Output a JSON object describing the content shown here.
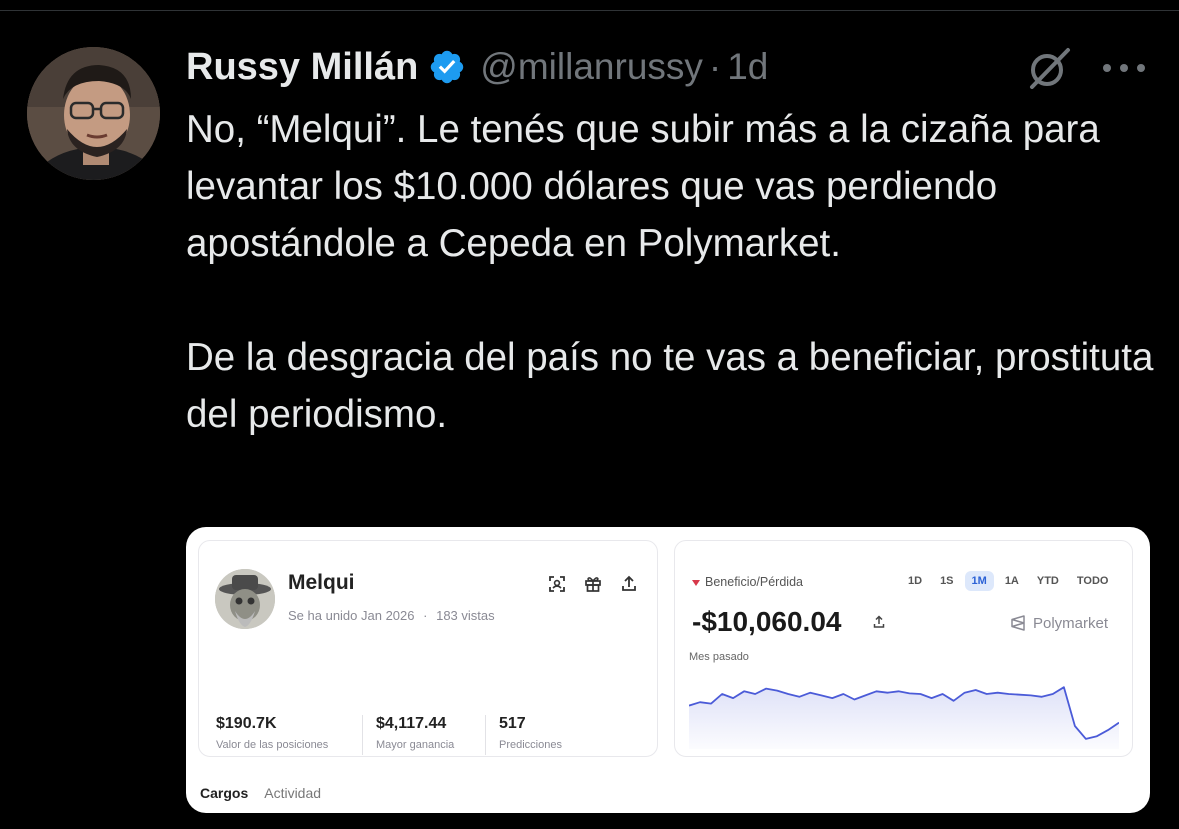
{
  "tweet": {
    "author_name": "Russy Millán",
    "handle": "@millanrussy",
    "separator": "·",
    "time": "1d",
    "paragraph_1": "No, “Melqui”. Le tenés que subir más a la cizaña para levantar los $10.000 dólares que vas perdiendo apostándole a Cepeda en Polymarket.",
    "paragraph_2": "De la desgracia del país no te vas a beneficiar, prostituta del periodismo.",
    "icons": [
      "verified-badge-icon",
      "grok-icon",
      "more-options-icon"
    ],
    "colors": {
      "background": "#000000",
      "text": "#e7e9ea",
      "muted": "#71767b",
      "verified": "#1d9bf0"
    }
  },
  "media": {
    "profile": {
      "name": "Melqui",
      "joined": "Se ha unido Jan 2026",
      "dot": "·",
      "views": "183 vistas",
      "icons": [
        "scan-icon",
        "gift-icon",
        "share-icon"
      ],
      "stats": [
        {
          "value": "$190.7K",
          "label": "Valor de las posiciones"
        },
        {
          "value": "$4,117.44",
          "label": "Mayor ganancia"
        },
        {
          "value": "517",
          "label": "Predicciones"
        }
      ]
    },
    "pnl": {
      "label": "Beneficio/Pérdida",
      "ranges": [
        "1D",
        "1S",
        "1M",
        "1A",
        "YTD",
        "TODO"
      ],
      "active_range": "1M",
      "value": "-$10,060.04",
      "brand": "Polymarket",
      "period": "Mes pasado",
      "line_color": "#4b5bd8",
      "trend": [
        0.55,
        0.6,
        0.58,
        0.72,
        0.66,
        0.76,
        0.72,
        0.8,
        0.77,
        0.72,
        0.68,
        0.74,
        0.7,
        0.66,
        0.72,
        0.64,
        0.7,
        0.76,
        0.74,
        0.76,
        0.73,
        0.72,
        0.66,
        0.72,
        0.62,
        0.74,
        0.78,
        0.72,
        0.74,
        0.72,
        0.71,
        0.7,
        0.68,
        0.72,
        0.82,
        0.25,
        0.06,
        0.1,
        0.19,
        0.3
      ]
    },
    "tabs": [
      "Cargos",
      "Actividad"
    ]
  }
}
